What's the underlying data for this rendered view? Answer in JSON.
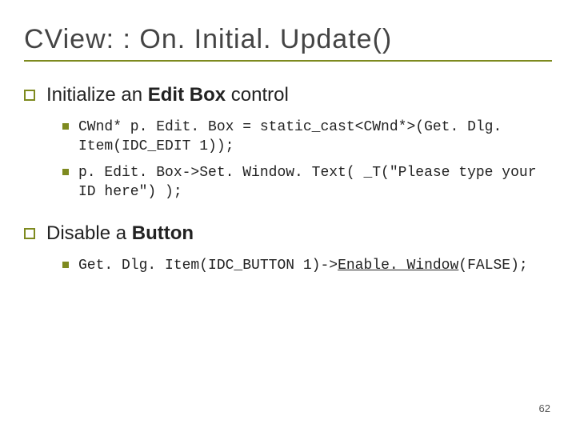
{
  "title": "CView: : On. Initial. Update()",
  "sections": [
    {
      "heading_prefix": "Initialize an ",
      "heading_bold": "Edit Box",
      "heading_suffix": " control",
      "items": [
        {
          "code": "CWnd* p. Edit. Box = static_cast<CWnd*>(Get. Dlg. Item(IDC_EDIT 1));"
        },
        {
          "code": "p. Edit. Box->Set. Window. Text( _T(\"Please type your ID here\") );"
        }
      ]
    },
    {
      "heading_prefix": "Disable a ",
      "heading_bold": "Button",
      "heading_suffix": "",
      "items": [
        {
          "code_html": "Get. Dlg. Item(IDC_BUTTON 1)-><span class=\"u\">Enable. Window</span>(FALSE);",
          "code": "Get. Dlg. Item(IDC_BUTTON 1)->Enable. Window(FALSE);"
        }
      ]
    }
  ],
  "page_number": "62"
}
